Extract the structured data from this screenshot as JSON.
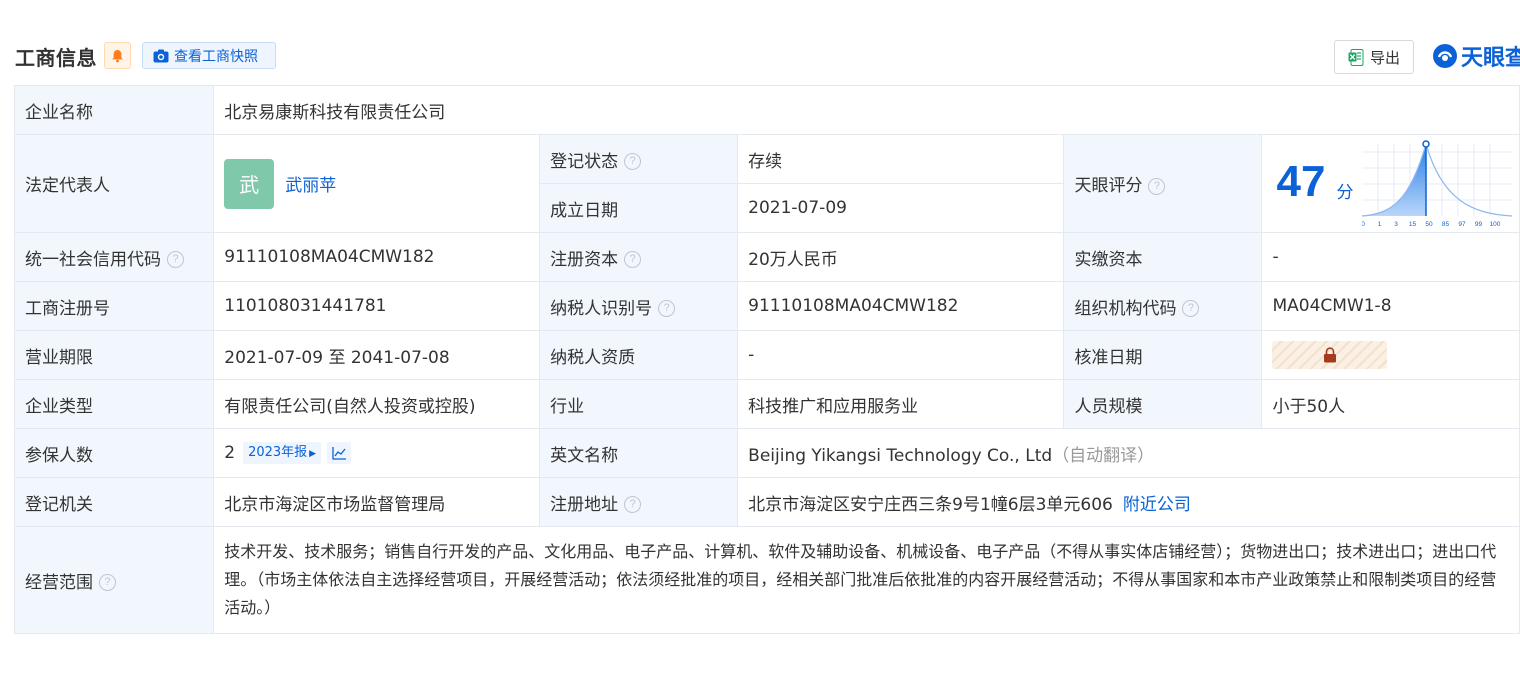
{
  "header": {
    "title": "工商信息",
    "snapshot_label": "查看工商快照",
    "export_label": "导出",
    "logo_text": "天眼查"
  },
  "rows": {
    "company_name_label": "企业名称",
    "company_name": "北京易康斯科技有限责任公司",
    "legal_rep_label": "法定代表人",
    "legal_rep_avatar": "武",
    "legal_rep_name": "武丽苹",
    "reg_status_label": "登记状态",
    "reg_status": "存续",
    "founded_label": "成立日期",
    "founded": "2021-07-09",
    "tianyan_score_label": "天眼评分",
    "tianyan_score": "47",
    "tianyan_score_unit": "分",
    "score_axis_ticks": [
      "0",
      "1",
      "3",
      "15",
      "50",
      "85",
      "97",
      "99",
      "100"
    ],
    "credit_code_label": "统一社会信用代码",
    "credit_code": "91110108MA04CMW182",
    "reg_capital_label": "注册资本",
    "reg_capital": "20万人民币",
    "paid_capital_label": "实缴资本",
    "paid_capital": "-",
    "biz_reg_no_label": "工商注册号",
    "biz_reg_no": "110108031441781",
    "taxpayer_id_label": "纳税人识别号",
    "taxpayer_id": "91110108MA04CMW182",
    "org_code_label": "组织机构代码",
    "org_code": "MA04CMW1-8",
    "biz_term_label": "营业期限",
    "biz_term": "2021-07-09 至 2041-07-08",
    "taxpayer_qual_label": "纳税人资质",
    "taxpayer_qual": "-",
    "approval_date_label": "核准日期",
    "company_type_label": "企业类型",
    "company_type": "有限责任公司(自然人投资或控股)",
    "industry_label": "行业",
    "industry": "科技推广和应用服务业",
    "staff_size_label": "人员规模",
    "staff_size": "小于50人",
    "insured_label": "参保人数",
    "insured": "2",
    "insured_report": "2023年报",
    "english_name_label": "英文名称",
    "english_name": "Beijing Yikangsi Technology Co., Ltd",
    "english_name_note": "（自动翻译）",
    "reg_authority_label": "登记机关",
    "reg_authority": "北京市海淀区市场监督管理局",
    "reg_address_label": "注册地址",
    "reg_address": "北京市海淀区安宁庄西三条9号1幢6层3单元606",
    "nearby_label": "附近公司",
    "scope_label": "经营范围",
    "scope": "技术开发、技术服务；销售自行开发的产品、文化用品、电子产品、计算机、软件及辅助设备、机械设备、电子产品（不得从事实体店铺经营）；货物进出口；技术进出口；进出口代理。（市场主体依法自主选择经营项目，开展经营活动；依法须经批准的项目，经相关部门批准后依批准的内容开展经营活动；不得从事国家和本市产业政策禁止和限制类项目的经营活动。）"
  },
  "colors": {
    "accent": "#0a62d6",
    "label_bg": "#f2f7fd",
    "active_status": "#12a054",
    "avatar_bg": "#7fc8a9"
  }
}
